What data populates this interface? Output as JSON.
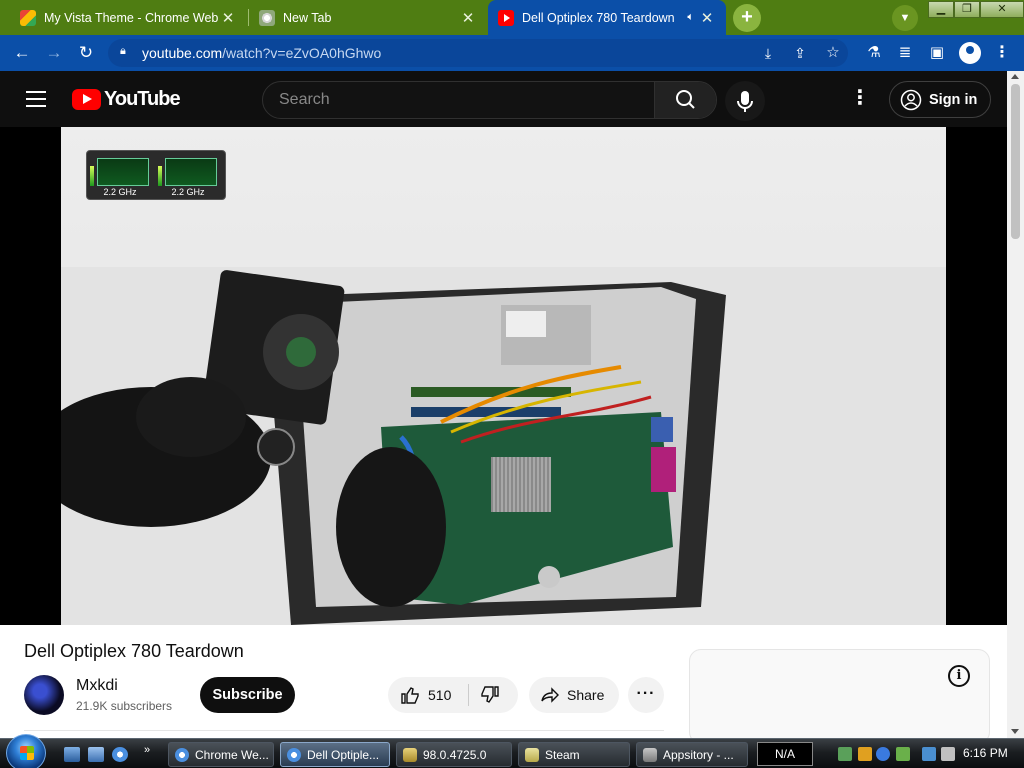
{
  "browser": {
    "tabs": [
      {
        "title": "My Vista Theme - Chrome Web Store",
        "favicon": "chrome-web-store-icon"
      },
      {
        "title": "New Tab",
        "favicon": "chrome-icon"
      },
      {
        "title": "Dell Optiplex 780 Teardown",
        "favicon": "youtube-icon",
        "audio": "speaker-icon"
      }
    ],
    "close_glyph": "✕",
    "new_tab_glyph": "+",
    "url_host": "youtube.com",
    "url_path": "/watch?v=eZvOA0hGhwo"
  },
  "youtube": {
    "logo_text": "YouTube",
    "search_placeholder": "Search",
    "signin_label": "Sign in"
  },
  "video": {
    "title": "Dell Optiplex 780 Teardown",
    "gadget": {
      "cpu1": "2.2 GHz",
      "cpu2": "2.2 GHz"
    },
    "channel": "Mxkdi",
    "subscribers": "21.9K subscribers",
    "subscribe_label": "Subscribe",
    "likes": "510",
    "share_label": "Share"
  },
  "taskbar": {
    "tasks": [
      {
        "label": "Chrome We...",
        "icon": "chrome-icon"
      },
      {
        "label": "Dell Optiple...",
        "icon": "chrome-icon",
        "active": true
      },
      {
        "label": "98.0.4725.0",
        "icon": "archive-icon"
      },
      {
        "label": "Steam",
        "icon": "steam-icon"
      },
      {
        "label": "Appsitory - ...",
        "icon": "appsitory-icon"
      }
    ],
    "na_label": "N/A",
    "time": "6:16 PM"
  },
  "colors": {
    "tabstrip": "#4f7d12",
    "toolbar": "#0b4fa8",
    "yt_red": "#ff0000",
    "yt_dark": "#0f0f0f"
  }
}
